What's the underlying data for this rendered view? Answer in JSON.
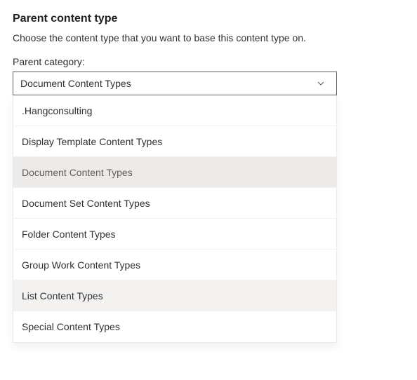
{
  "section": {
    "title": "Parent content type",
    "description": "Choose the content type that you want to base this content type on."
  },
  "field": {
    "label": "Parent category:",
    "selected": "Document Content Types"
  },
  "options": [
    {
      "label": ".Hangconsulting",
      "state": "normal"
    },
    {
      "label": "Display Template Content Types",
      "state": "normal"
    },
    {
      "label": "Document Content Types",
      "state": "selected"
    },
    {
      "label": "Document Set Content Types",
      "state": "normal"
    },
    {
      "label": "Folder Content Types",
      "state": "normal"
    },
    {
      "label": "Group Work Content Types",
      "state": "normal"
    },
    {
      "label": "List Content Types",
      "state": "hovered"
    },
    {
      "label": "Special Content Types",
      "state": "normal"
    }
  ]
}
